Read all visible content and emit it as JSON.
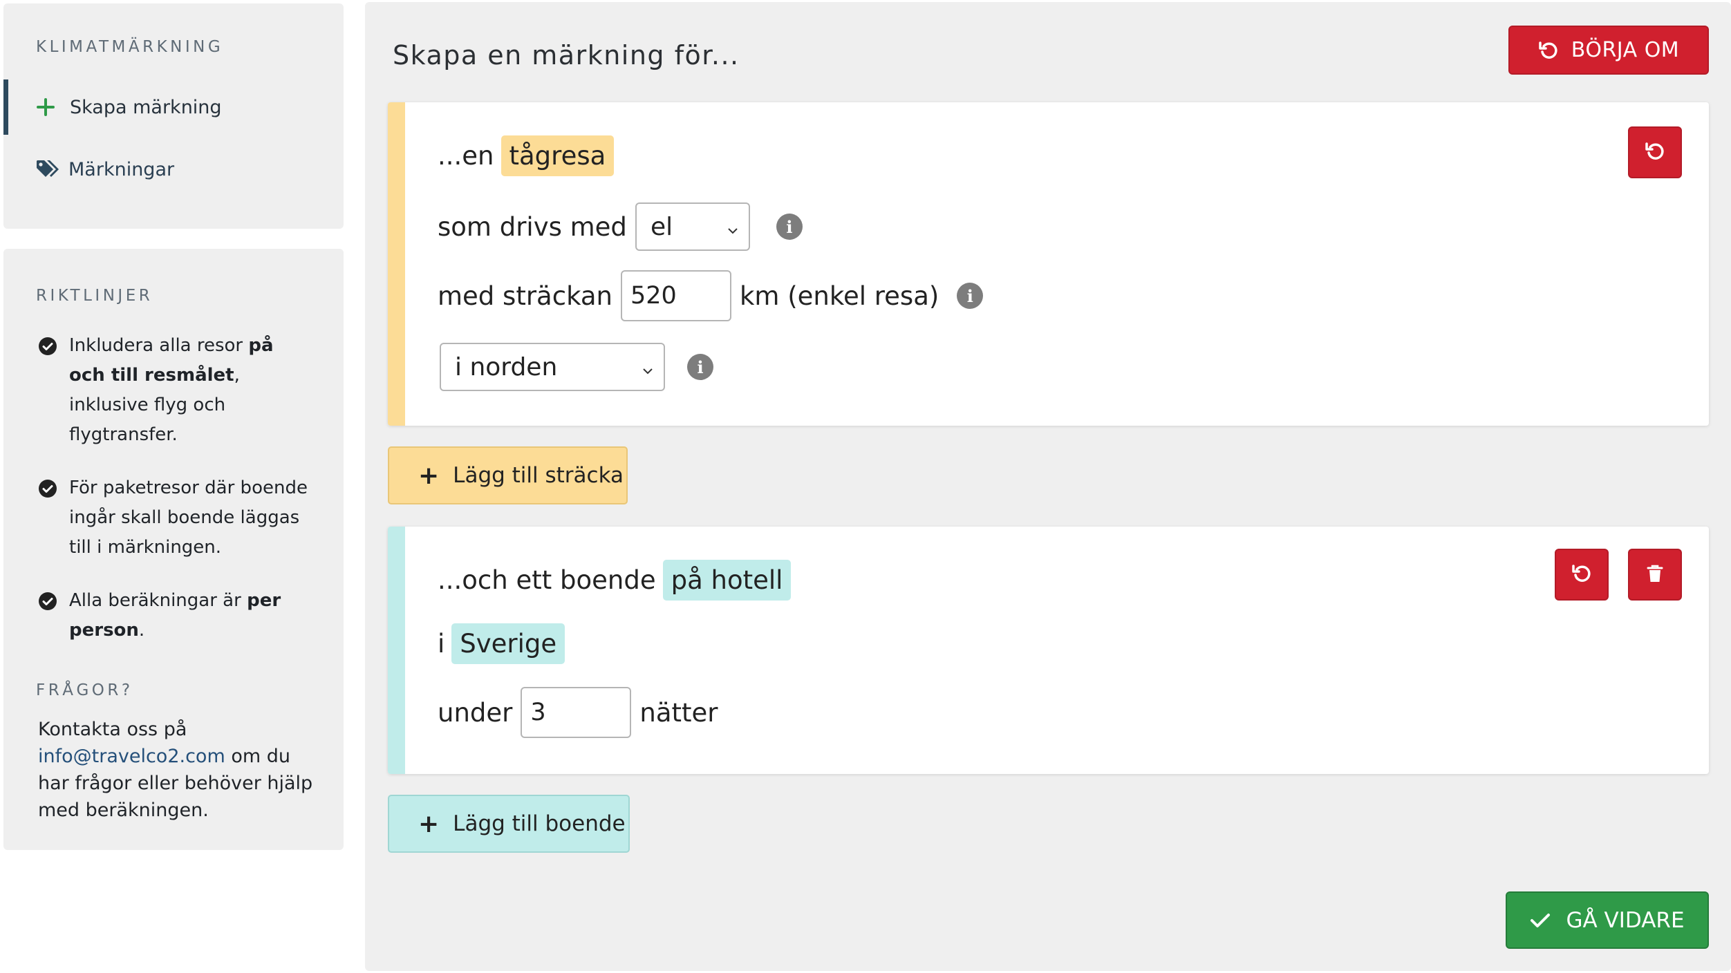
{
  "sidebar": {
    "brand": "KLIMATMÄRKNING",
    "nav": [
      {
        "label": "Skapa märkning",
        "icon": "plus-icon"
      },
      {
        "label": "Märkningar",
        "icon": "tags-icon"
      }
    ],
    "guidelines_title": "RIKTLINJER",
    "guidelines": [
      {
        "pre": "Inkludera alla resor ",
        "bold": "på och till resmålet",
        "post": ", inklusive flyg och flygtransfer."
      },
      {
        "pre": "För paketresor där boende ingår skall boende läggas till i märkningen.",
        "bold": "",
        "post": ""
      },
      {
        "pre": "Alla beräkningar är ",
        "bold": "per person",
        "post": "."
      }
    ],
    "questions_title": "FRÅGOR?",
    "contact_pre": "Kontakta oss på",
    "contact_email": "info@travelco2.com",
    "contact_post": "om du har frågor eller behöver hjälp med beräkningen."
  },
  "main": {
    "title": "Skapa en märkning för...",
    "restart_label": "BÖRJA OM",
    "trip": {
      "intro": "...en",
      "type": "tågresa",
      "fuel_label": "som drivs med",
      "fuel_value": "el",
      "distance_label": "med sträckan",
      "distance_value": "520",
      "distance_unit": "km (enkel resa)",
      "region_value": "i norden"
    },
    "add_leg_label": "Lägg till sträcka",
    "stay": {
      "intro": "...och ett boende",
      "type": "på hotell",
      "country_prefix": "i",
      "country": "Sverige",
      "nights_label": "under",
      "nights_value": "3",
      "nights_unit": "nätter"
    },
    "add_stay_label": "Lägg till boende",
    "next_label": "GÅ VIDARE"
  },
  "colors": {
    "red": "#d0202e",
    "green": "#2f9a48",
    "yellow": "#fcdc96",
    "teal": "#c0ecea"
  }
}
